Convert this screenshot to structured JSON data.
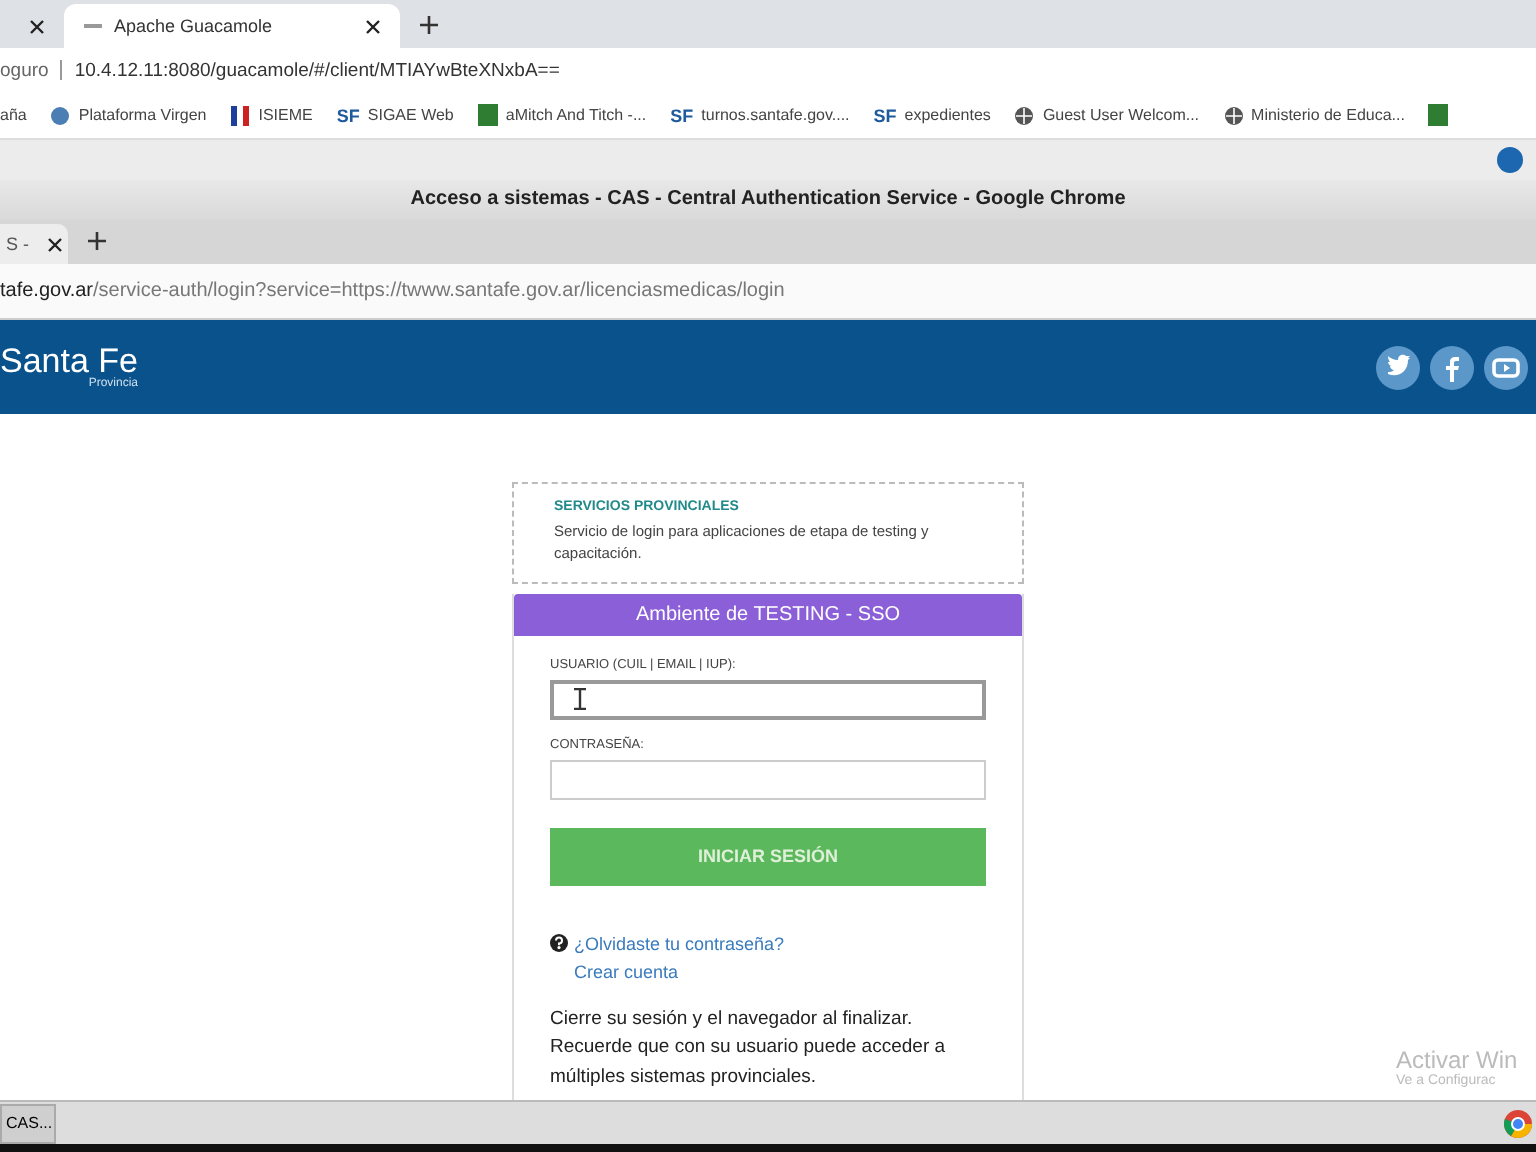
{
  "outer_browser": {
    "tabs": [
      {
        "selected": false
      },
      {
        "label": "Apache Guacamole",
        "selected": true
      }
    ],
    "address": {
      "security": "oguro",
      "url": "10.4.12.11:8080/guacamole/#/client/MTIAYwBteXNxbA=="
    },
    "bookmarks": [
      {
        "kind": "text",
        "label": "aña"
      },
      {
        "kind": "wp",
        "label": "Plataforma Virgen"
      },
      {
        "kind": "flag",
        "label": "ISIEME"
      },
      {
        "kind": "sf",
        "badge": "SF",
        "label": "SIGAE Web"
      },
      {
        "kind": "green",
        "label": "aMitch And Titch -..."
      },
      {
        "kind": "sf",
        "badge": "SF",
        "label": "turnos.santafe.gov...."
      },
      {
        "kind": "sf",
        "badge": "SF",
        "label": "expedientes"
      },
      {
        "kind": "globe",
        "label": "Guest User Welcom..."
      },
      {
        "kind": "globe",
        "label": "Ministerio de Educa..."
      },
      {
        "kind": "green"
      }
    ]
  },
  "remote_window": {
    "title": "Acceso a sistemas - CAS - Central Authentication Service - Google Chrome",
    "tabs": [
      {
        "label": "S -",
        "selected": true
      }
    ],
    "url": {
      "host": "tafe.gov.ar",
      "path": "/service-auth/login?service=https://twww.santafe.gov.ar/licenciasmedicas/login"
    }
  },
  "site_header": {
    "logo": "Santa Fe",
    "logo_sub": "Provincia"
  },
  "info_box": {
    "title": "SERVICIOS PROVINCIALES",
    "text": "Servicio de login para aplicaciones de etapa de testing y capacitación."
  },
  "login": {
    "header": "Ambiente de TESTING - SSO",
    "fields": [
      {
        "label": "USUARIO (CUIL | EMAIL | IUP):",
        "focused": true
      },
      {
        "label": "CONTRASEÑA:",
        "focused": false
      }
    ],
    "submit": "INICIAR SESIÓN",
    "forgot": "¿Olvidaste tu contraseña?",
    "create": "Crear cuenta",
    "note": "Cierre su sesión y el navegador al finalizar. Recuerde que con su usuario puede acceder a múltiples sistemas provinciales."
  },
  "activation_notice": {
    "title": "Activar Win",
    "text": "Ve a Configurac"
  },
  "taskbar": {
    "items": [
      {
        "label": "CAS...",
        "selected": true
      }
    ]
  }
}
